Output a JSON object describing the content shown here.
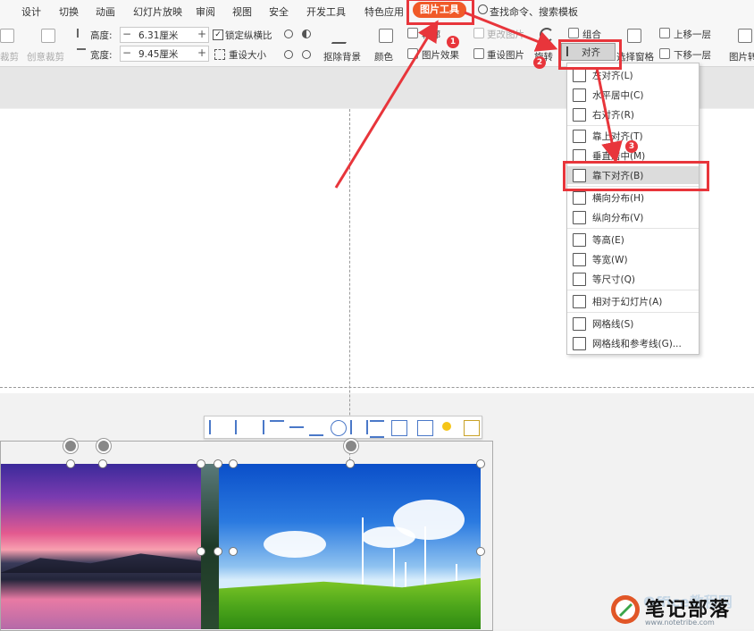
{
  "tabs": {
    "items": [
      "设计",
      "切换",
      "动画",
      "幻灯片放映",
      "审阅",
      "视图",
      "安全",
      "开发工具",
      "特色应用"
    ],
    "active": "图片工具",
    "search_label": "查找命令、搜索模板"
  },
  "ribbon": {
    "crop_label": "裁剪",
    "creative_crop_label": "创意裁剪",
    "height_label": "高度:",
    "height_value": "6.31厘米",
    "width_label": "宽度:",
    "width_value": "9.45厘米",
    "lock_ratio_label": "锁定纵横比",
    "reset_size_label": "重设大小",
    "remove_bg_label": "抠除背景",
    "color_label": "颜色",
    "outline_label": "轮廓",
    "effect_label": "图片效果",
    "change_pic_label": "更改图片",
    "reset_pic_label": "重设图片",
    "rotate_label": "旋转",
    "combine_label": "组合",
    "align_label": "对齐",
    "selection_pane_label": "选择窗格",
    "bring_forward_label": "上移一层",
    "send_backward_label": "下移一层",
    "picture_label": "图片转"
  },
  "align_menu": {
    "items": [
      {
        "label": "左对齐(L)",
        "icon": "align-left-icon"
      },
      {
        "label": "水平居中(C)",
        "icon": "align-center-icon"
      },
      {
        "label": "右对齐(R)",
        "icon": "align-right-icon"
      },
      {
        "label": "靠上对齐(T)",
        "icon": "align-top-icon"
      },
      {
        "label": "垂直居中(M)",
        "icon": "align-middle-icon"
      },
      {
        "label": "靠下对齐(B)",
        "icon": "align-bottom-icon"
      },
      {
        "label": "横向分布(H)",
        "icon": "distribute-horizontal-icon"
      },
      {
        "label": "纵向分布(V)",
        "icon": "distribute-vertical-icon"
      },
      {
        "label": "等高(E)",
        "icon": "same-height-icon"
      },
      {
        "label": "等宽(W)",
        "icon": "same-width-icon"
      },
      {
        "label": "等尺寸(Q)",
        "icon": "same-size-icon"
      },
      {
        "label": "相对于幻灯片(A)",
        "icon": "relative-to-slide-icon"
      },
      {
        "label": "网格线(S)",
        "icon": "gridlines-icon"
      },
      {
        "label": "网格线和参考线(G)...",
        "icon": "gridlines-guides-icon"
      }
    ],
    "highlighted": "靠下对齐(B)"
  },
  "callouts": [
    "1",
    "2",
    "3"
  ],
  "watermark": {
    "text": "笔记部落",
    "url": "www.notetribe.com",
    "faded_text": "Office教程网"
  },
  "colors": {
    "accent": "#f05a28",
    "callout_red": "#e8353b",
    "menu_highlight": "#dcdcdc"
  }
}
